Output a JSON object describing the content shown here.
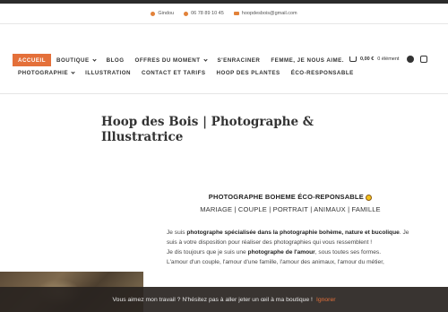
{
  "contact": {
    "location": "Gindou",
    "phone": "06 78 89 10 45",
    "email": "hoopdesbois@gmail.com"
  },
  "nav": {
    "row1": [
      {
        "label": "ACCUEIL",
        "active": true
      },
      {
        "label": "BOUTIQUE",
        "dropdown": true
      },
      {
        "label": "BLOG"
      },
      {
        "label": "OFFRES DU MOMENT",
        "dropdown": true
      },
      {
        "label": "S'ENRACINER"
      },
      {
        "label": "FEMME, JE NOUS AIME."
      }
    ],
    "row2": [
      {
        "label": "PHOTOGRAPHIE",
        "dropdown": true
      },
      {
        "label": "ILLUSTRATION"
      },
      {
        "label": "CONTACT ET TARIFS"
      },
      {
        "label": "HOOP DES PLANTES"
      },
      {
        "label": "ÉCO-RESPONSABLE"
      }
    ]
  },
  "cart": {
    "amount": "0,00 €",
    "count": "0 élément"
  },
  "social": {
    "icons": [
      "facebook-icon",
      "instagram-icon"
    ]
  },
  "page": {
    "title": "Hoop des Bois | Photographe & Illustratrice",
    "tagline_main": "PHOTOGRAPHE BOHEME ÉCO-REPONSABLE",
    "tagline_sub": "MARIAGE | COUPLE | PORTRAIT | ANIMAUX | FAMILLE"
  },
  "body": {
    "p1_a": "Je suis ",
    "p1_b": "photographe spécialisée dans la photographie bohème, nature et bucolique",
    "p1_c": ". Je suis à votre disposition pour réaliser des photographies qui vous ressemblent !",
    "p2_a": "Je dis toujours que je suis une ",
    "p2_b": "photographe de l'amour",
    "p2_c": ", sous toutes ses formes.",
    "p3": "L'amour d'un couple, l'amour d'une famille, l'amour des animaux, l'amour du métier,"
  },
  "notice": {
    "text": "Vous aimez mon travail ? N'hésitez pas à aller jeter un œil à ma boutique !",
    "dismiss": "Ignorer"
  },
  "colors": {
    "accent": "#e4703a",
    "notice_bg": "#282320"
  }
}
